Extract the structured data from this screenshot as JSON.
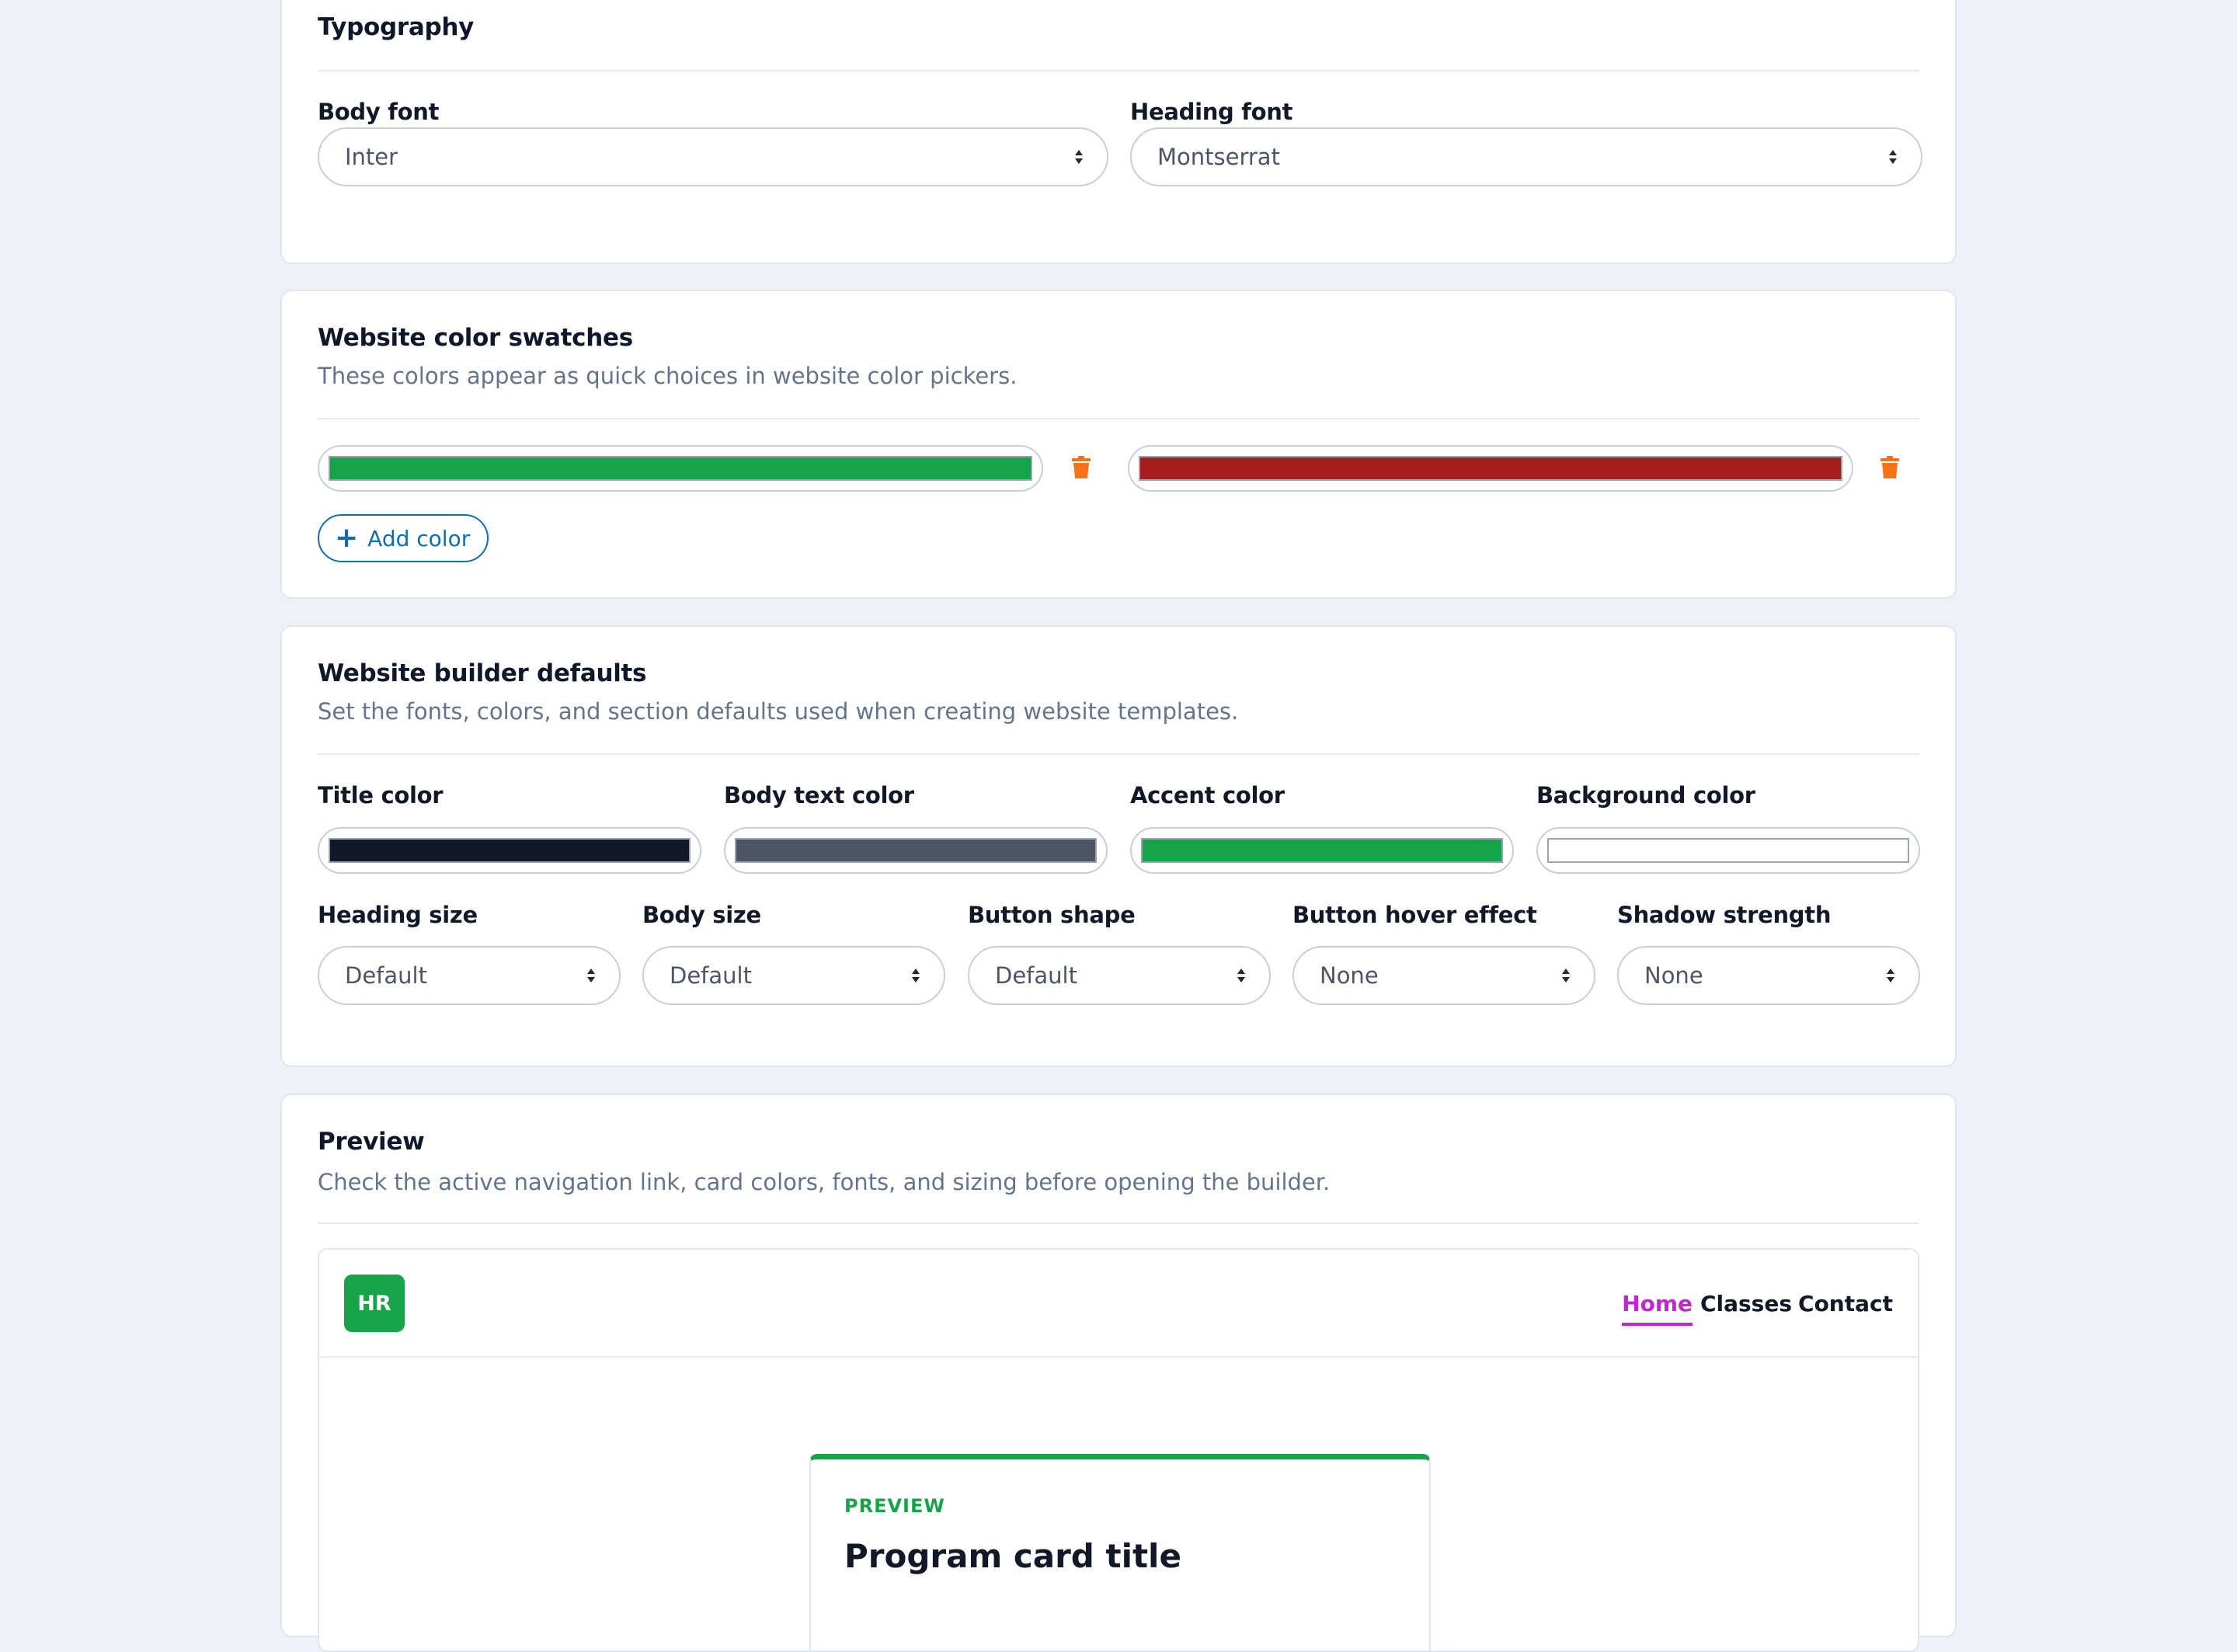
{
  "typography": {
    "title": "Typography",
    "body_font_label": "Body font",
    "body_font_value": "Inter",
    "heading_font_label": "Heading font",
    "heading_font_value": "Montserrat"
  },
  "swatches": {
    "title": "Website color swatches",
    "description": "These colors appear as quick choices in website color pickers.",
    "colors": [
      "#16a34a",
      "#a61d1d"
    ],
    "add_label": "Add color"
  },
  "builder": {
    "title": "Website builder defaults",
    "description": "Set the fonts, colors, and section defaults used when creating website templates.",
    "color_fields": [
      {
        "label": "Title color",
        "value": "#111827"
      },
      {
        "label": "Body text color",
        "value": "#4b5563"
      },
      {
        "label": "Accent color",
        "value": "#16a34a"
      },
      {
        "label": "Background color",
        "value": "#ffffff"
      }
    ],
    "select_fields": [
      {
        "label": "Heading size",
        "value": "Default"
      },
      {
        "label": "Body size",
        "value": "Default"
      },
      {
        "label": "Button shape",
        "value": "Default"
      },
      {
        "label": "Button hover effect",
        "value": "None"
      },
      {
        "label": "Shadow strength",
        "value": "None"
      }
    ]
  },
  "preview": {
    "title": "Preview",
    "description": "Check the active navigation link, card colors, fonts, and sizing before opening the builder.",
    "logo": "HR",
    "nav": [
      "Home",
      "Classes",
      "Contact"
    ],
    "active_nav": "Home",
    "active_color": "#c026d3",
    "card_eyebrow": "PREVIEW",
    "card_title": "Program card title"
  }
}
